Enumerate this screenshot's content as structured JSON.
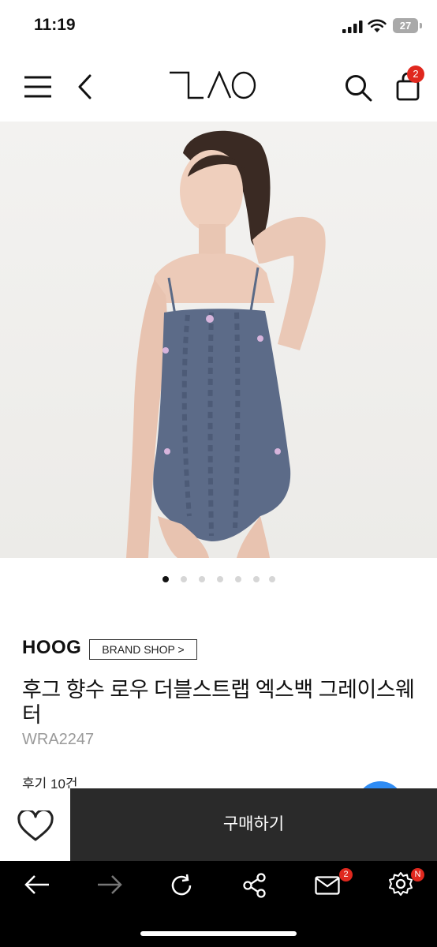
{
  "status_bar": {
    "time": "11:19",
    "battery": "27"
  },
  "header": {
    "logo": "TAO",
    "cart_count": "2"
  },
  "gallery": {
    "image_count": 7,
    "active_index": 0
  },
  "product": {
    "brand": "HOOG",
    "brand_shop_label": "BRAND SHOP >",
    "name": "후그 향수 로우 더블스트랩 엑스백 그레이스웨터",
    "code": "WRA2247",
    "reviews": "후기 10건"
  },
  "actions": {
    "buy_label": "구매하기"
  },
  "browser_bar": {
    "mail_badge": "2",
    "settings_badge": "N"
  }
}
